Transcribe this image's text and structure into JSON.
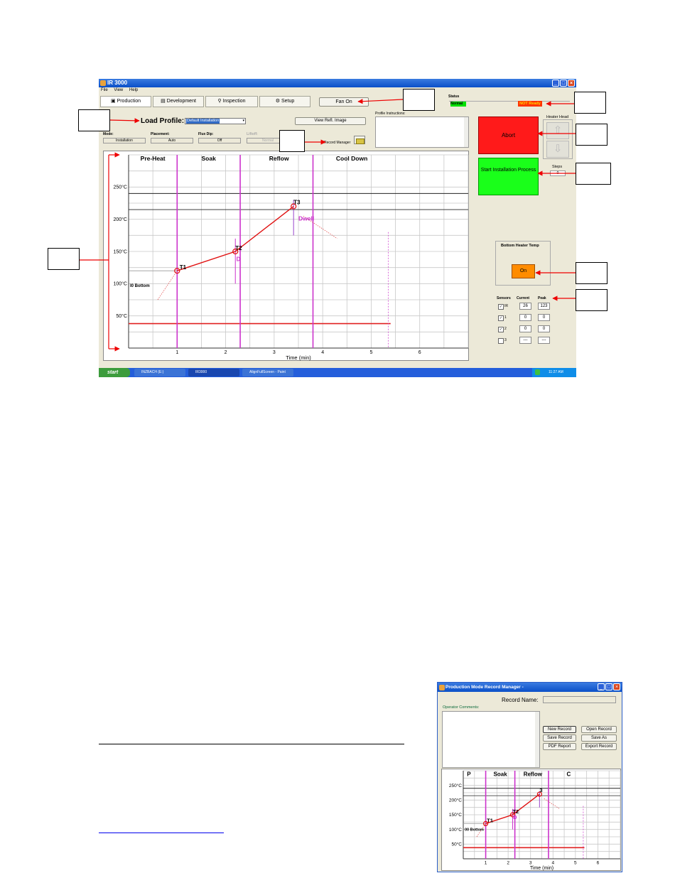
{
  "window": {
    "title": "IR 3000",
    "menu": [
      "File",
      "View",
      "Help"
    ],
    "tabs": [
      "Production",
      "Development",
      "Inspection",
      "Setup"
    ],
    "fan_button": "Fan On",
    "status_label": "Status",
    "status_left": "Normal",
    "status_right": "NOT Ready",
    "load_profile_label": "Load Profile:",
    "profile_selected": "Default Installation",
    "view_refl_button": "View Refl. Image",
    "profile_instructions_label": "Profile Instructions:",
    "record_manager_label": "Record Manager",
    "fields": [
      {
        "label": "Mode:",
        "value": "Installation"
      },
      {
        "label": "Placement:",
        "value": "Auto"
      },
      {
        "label": "Flux Dip:",
        "value": "Off"
      },
      {
        "label": "Liftoff:",
        "value": "Normal"
      }
    ],
    "abort_button": "Abort",
    "start_button": "Start Installation Process",
    "heater_head_label": "Heater Head",
    "steps_label": "Steps",
    "steps_value": "0",
    "bottom_heater_label": "Bottom Heater Temp",
    "bottom_heater_button": "On",
    "sensors_header": [
      "Sensors",
      "Current",
      "Peak"
    ],
    "sensors": [
      {
        "name": "IR",
        "checked": true,
        "current": "26",
        "peak": "123"
      },
      {
        "name": "1",
        "checked": true,
        "current": "0",
        "peak": "0"
      },
      {
        "name": "2",
        "checked": true,
        "current": "0",
        "peak": "0"
      },
      {
        "name": "3",
        "checked": false,
        "current": "---",
        "peak": "---"
      }
    ],
    "taskbar": {
      "start": "start",
      "items": [
        "INZBACH (E:)",
        "IR3000",
        "AlignFullScreen - Paint"
      ],
      "clock": "11:27 AM"
    }
  },
  "main_chart": {
    "phases": [
      "Pre-Heat",
      "Soak",
      "Reflow",
      "Cool Down"
    ],
    "y_ticks": [
      "250°C",
      "200°C",
      "150°C",
      "100°C",
      "50°C"
    ],
    "x_ticks": [
      "1",
      "2",
      "3",
      "4",
      "5",
      "6"
    ],
    "xlabel": "Time (min)",
    "labels": [
      "T1",
      "T2",
      "T3",
      "D",
      "Dwell",
      "I0 Bottom"
    ]
  },
  "chart_data": {
    "type": "line",
    "xlabel": "Time (min)",
    "ylabel": "",
    "xlim": [
      0,
      7
    ],
    "ylim": [
      0,
      300
    ],
    "series": [
      {
        "x": [
          1.0,
          2.2,
          3.4
        ],
        "y": [
          120,
          150,
          220
        ]
      }
    ],
    "phase_labels": [
      "Pre-Heat",
      "Soak",
      "Reflow",
      "Cool Down"
    ],
    "phase_boundaries": [
      1.0,
      2.3,
      3.8
    ],
    "reference_lines_y": [
      240,
      215,
      38
    ],
    "grid": true
  },
  "record_manager": {
    "title": "Production Mode Record Manager -",
    "record_name_label": "Record Name:",
    "operator_comments_label": "Operator Comments:",
    "buttons": [
      "New Record",
      "Open Record",
      "Save Record",
      "Save As",
      "PDF Report",
      "Export Record"
    ],
    "chart_phases": [
      "P",
      "Soak",
      "Reflow",
      "C"
    ],
    "chart_labels": [
      "T1",
      "T2",
      "3",
      "D",
      "00 Bottom"
    ],
    "y_ticks": [
      "250°C",
      "200°C",
      "150°C",
      "100°C",
      "50°C"
    ],
    "x_ticks": [
      "1",
      "2",
      "3",
      "4",
      "5",
      "6"
    ],
    "xlabel": "Time (min)"
  }
}
